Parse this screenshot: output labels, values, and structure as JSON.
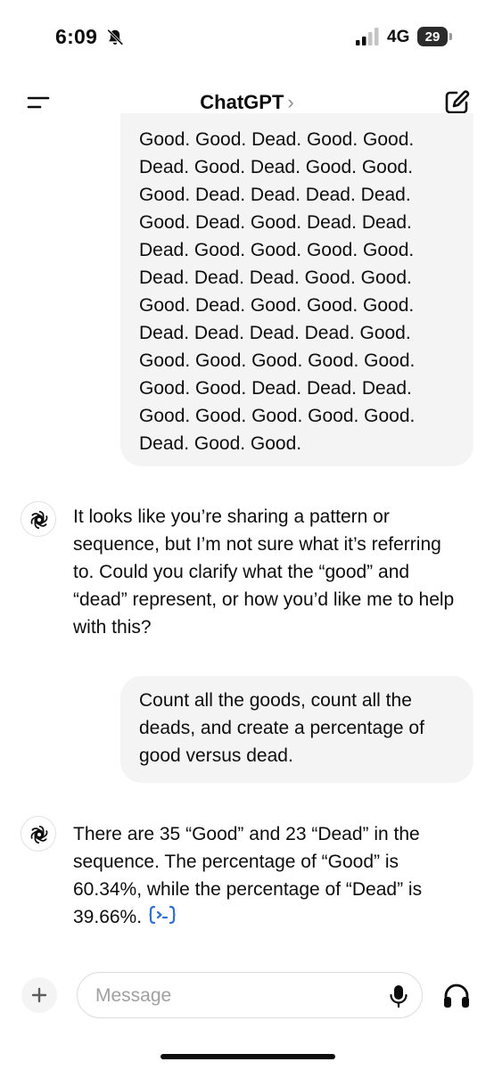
{
  "status_bar": {
    "time": "6:09",
    "network": "4G",
    "battery_level": "29",
    "icons": [
      "bell-slash-icon",
      "signal-icon",
      "battery-icon"
    ]
  },
  "header": {
    "title": "ChatGPT",
    "chevron": "›",
    "menu_icon": "menu-icon",
    "compose_icon": "new-chat-icon"
  },
  "messages": [
    {
      "role": "user",
      "text": "Good. Good. Dead. Good. Good.\nDead. Good. Dead. Good. Good.\nGood. Dead. Dead. Dead. Dead.\nGood. Dead. Good. Dead. Dead.\nDead. Good. Good. Good. Good.\nDead. Dead. Dead. Good. Good.\nGood. Dead. Good. Good. Good.\nDead. Dead. Dead. Dead. Good.\nGood. Good. Good. Good. Good.\nGood. Good. Dead. Dead. Dead.\nGood. Good. Good. Good. Good.\nDead. Good. Good."
    },
    {
      "role": "assistant",
      "text": "It looks like you’re sharing a pattern or sequence, but I’m not sure what it’s referring to. Could you clarify what the “good” and “dead” represent, or how you’d like me to help with this?"
    },
    {
      "role": "user",
      "text": "Count all the goods, count all the deads, and create a percentage of good versus dead."
    },
    {
      "role": "assistant",
      "text": "There are 35 “Good” and 23 “Dead” in the sequence. The percentage of “Good” is 60.34%, while the percentage of “Dead” is 39.66%.",
      "trailing_icon": "code-analysis-icon"
    }
  ],
  "composer": {
    "placeholder": "Message",
    "value": "",
    "icons": [
      "plus-icon",
      "microphone-icon",
      "headphones-icon"
    ]
  },
  "colors": {
    "background": "#ffffff",
    "user_bubble": "#f4f4f4",
    "text": "#0d0d0d",
    "placeholder": "#a0a0a0",
    "code_icon": "#2f6fd6",
    "muted": "#8e8e8e"
  }
}
